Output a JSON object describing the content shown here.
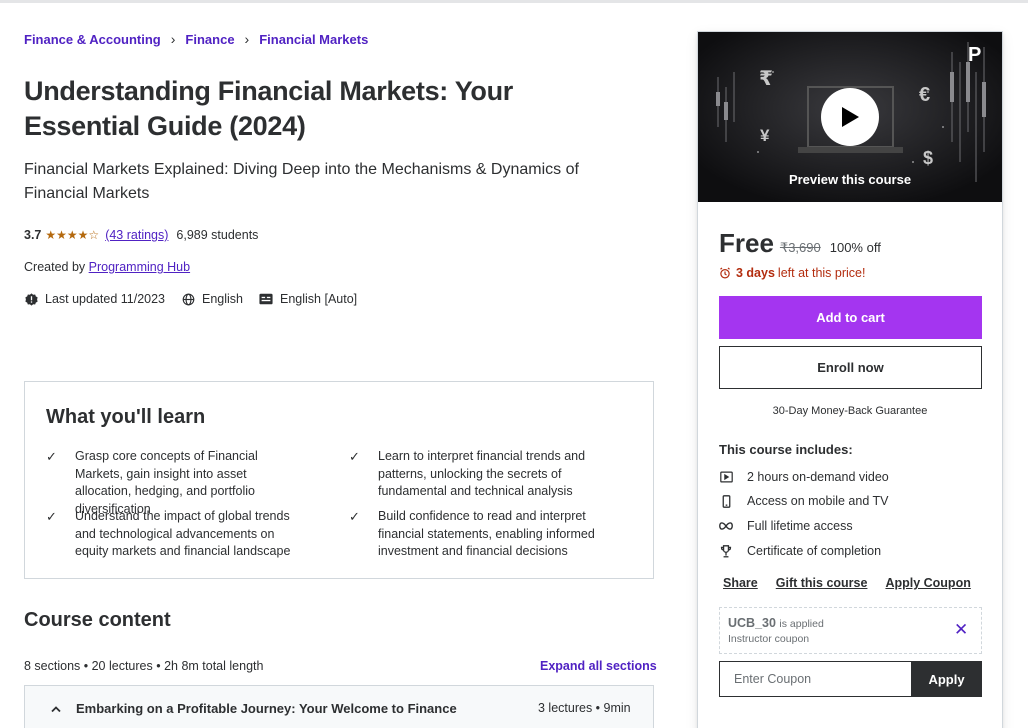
{
  "breadcrumb": [
    {
      "label": "Finance & Accounting"
    },
    {
      "label": "Finance"
    },
    {
      "label": "Financial Markets"
    }
  ],
  "course": {
    "title_line1": "Understanding Financial Markets: Your",
    "title_line2": "Essential Guide (2024)",
    "subtitle": "Financial Markets Explained: Diving Deep into the Mechanisms & Dynamics of Financial Markets",
    "rating": "3.7",
    "stars": "★★★★☆",
    "ratings_count": "(43 ratings)",
    "students": "6,989 students",
    "created_by_label": "Created by",
    "instructor": "Programming Hub",
    "last_updated": "Last updated 11/2023",
    "language": "English",
    "captions": "English [Auto]"
  },
  "learn": {
    "title": "What you'll learn",
    "items": [
      "Grasp core concepts of Financial Markets, gain insight into asset allocation, hedging, and portfolio diversification",
      "Learn to interpret financial trends and patterns, unlocking the secrets of fundamental and technical analysis",
      "Understand the impact of global trends and technological advancements on equity markets and financial landscape",
      "Build confidence to read and interpret financial statements, enabling informed investment and financial decisions"
    ]
  },
  "content": {
    "title": "Course content",
    "meta": "8 sections • 20 lectures • 2h 8m total length",
    "expand_all": "Expand all sections",
    "sections": [
      {
        "title": "Embarking on a Profitable Journey: Your Welcome to Finance",
        "meta": "3 lectures • 9min"
      }
    ]
  },
  "sidebar": {
    "preview_label": "Preview this course",
    "price": "Free",
    "original_price": "₹3,690",
    "discount": "100% off",
    "deadline_bold": "3 days",
    "deadline_rest": "left at this price!",
    "add_to_cart": "Add to cart",
    "enroll_now": "Enroll now",
    "guarantee": "30-Day Money-Back Guarantee",
    "includes_title": "This course includes:",
    "includes": [
      {
        "icon": "video-icon",
        "label": "2 hours on-demand video"
      },
      {
        "icon": "mobile-icon",
        "label": "Access on mobile and TV"
      },
      {
        "icon": "infinity-icon",
        "label": "Full lifetime access"
      },
      {
        "icon": "trophy-icon",
        "label": "Certificate of completion"
      }
    ],
    "share": "Share",
    "gift": "Gift this course",
    "apply_coupon": "Apply Coupon",
    "coupon_code": "UCB_30",
    "coupon_applied": "is applied",
    "coupon_type": "Instructor coupon",
    "coupon_placeholder": "Enter Coupon",
    "apply_button": "Apply"
  },
  "colors": {
    "accent_purple": "#a435f0",
    "link_purple": "#5022c3",
    "text_dark": "#2d2f31",
    "star_orange": "#b4690e",
    "alert_red": "#b32d0f"
  }
}
